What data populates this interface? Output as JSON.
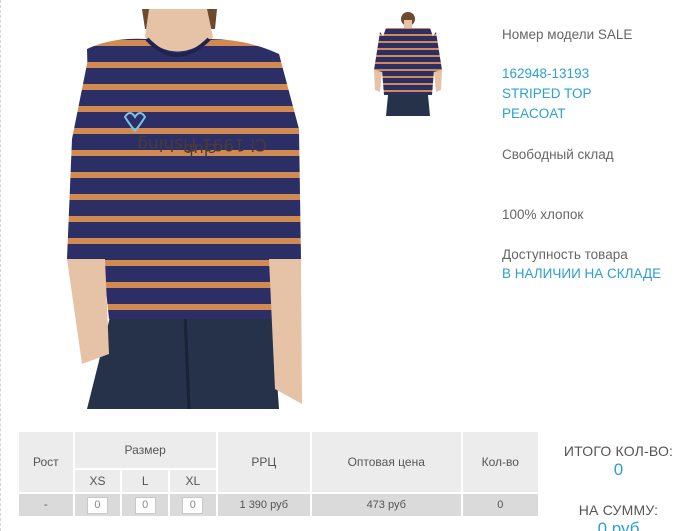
{
  "product": {
    "model_number": "Номер модели SALE",
    "article": "162948-13193",
    "name": "STRIPED TOP",
    "color": "PEACOAT",
    "warehouse": "Свободный склад",
    "composition": "100% хлопок",
    "availability_label": "Доступность товара",
    "availability_value": "В НАЛИЧИИ НА СКЛАДЕ",
    "print_text_line1": "Ci 1991 Fishing",
    "print_text_line2": "club"
  },
  "table": {
    "headers": {
      "height": "Рост",
      "size": "Размер",
      "rrp": "РРЦ",
      "wholesale": "Оптовая цена",
      "qty": "Кол-во"
    },
    "sizes": [
      "XS",
      "L",
      "XL"
    ],
    "row": {
      "height": "-",
      "size_qty": [
        "0",
        "0",
        "0"
      ],
      "rrp": "1 390 руб",
      "wholesale": "473 руб",
      "qty": "0"
    }
  },
  "totals": {
    "total_qty_label": "ИТОГО КОЛ-ВО:",
    "total_qty_value": "0",
    "total_sum_label": "НА СУММУ:",
    "total_sum_value": "0 руб"
  },
  "colors": {
    "accent": "#2ba0d1",
    "navy": "#2b2f66",
    "stripe": "#d08a52",
    "denim": "#25324a",
    "skin": "#e6c3a6"
  },
  "icons": {
    "main_photo": "product-photo",
    "thumbnail": "product-thumbnail"
  }
}
